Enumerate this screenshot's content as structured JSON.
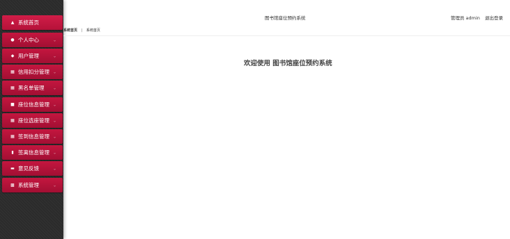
{
  "header": {
    "title": "图书馆座位预约系统",
    "user_role": "管理员",
    "username": "admin",
    "logout_label": "退出登录"
  },
  "breadcrumb": {
    "home": "系统首页",
    "separator": "|",
    "current": "系统首页"
  },
  "main": {
    "welcome_text": "欢迎使用 图书馆座位预约系统"
  },
  "sidebar": {
    "items": [
      {
        "label": "系统首页",
        "icon": "home-icon"
      },
      {
        "label": "个人中心",
        "icon": "user-icon"
      },
      {
        "label": "用户管理",
        "icon": "users-icon"
      },
      {
        "label": "信用扣分管理",
        "icon": "grid-icon"
      },
      {
        "label": "黑名单管理",
        "icon": "grid-icon"
      },
      {
        "label": "座位信息管理",
        "icon": "seat-icon"
      },
      {
        "label": "座位选座管理",
        "icon": "grid-icon"
      },
      {
        "label": "签到信息管理",
        "icon": "grid-icon"
      },
      {
        "label": "签离信息管理",
        "icon": "clipboard-icon"
      },
      {
        "label": "意见反馈",
        "icon": "comment-icon"
      },
      {
        "label": "系统管理",
        "icon": "chart-icon"
      }
    ]
  },
  "colors": {
    "sidebar_bg": "#2b2b2b",
    "menu_item": "#b8123a",
    "page_bg": "#ffffff"
  }
}
